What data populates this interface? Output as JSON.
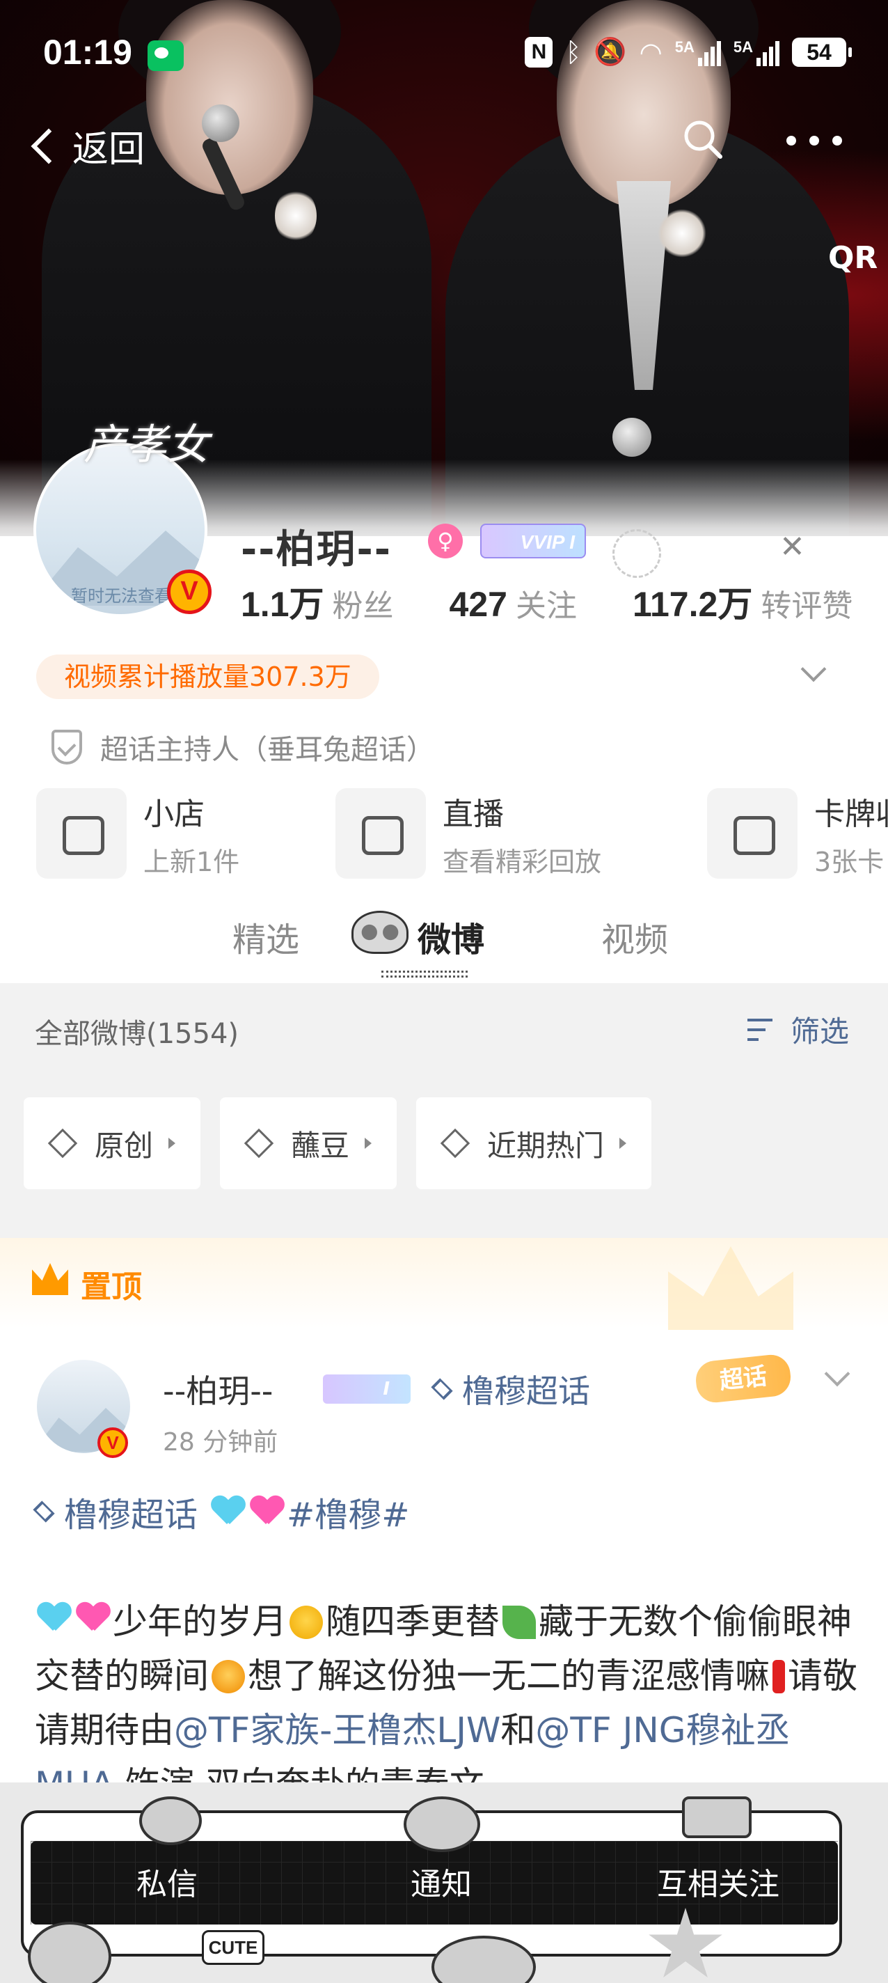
{
  "status_bar": {
    "time": "01:19",
    "nfc": "N",
    "network1": "5A",
    "network2": "5A",
    "battery": "54"
  },
  "nav": {
    "back_label": "返回"
  },
  "profile": {
    "avatar_caption": "暂时无法查看",
    "avatar_deco": "产孝女",
    "verified_mark": "V",
    "name": "--柏玥--",
    "vip_badge": "VVIP I",
    "stats": {
      "fans_count": "1.1万",
      "fans_label": "粉丝",
      "following_count": "427",
      "following_label": "关注",
      "likes_count": "117.2万",
      "likes_label": "转评赞"
    },
    "video_plays": "视频累计播放量307.3万",
    "host_text": "超话主持人（垂耳兔超话）"
  },
  "services": [
    {
      "title": "小店",
      "subtitle": "上新1件"
    },
    {
      "title": "直播",
      "subtitle": "查看精彩回放"
    },
    {
      "title": "卡牌收",
      "subtitle": "3张卡"
    }
  ],
  "tabs": [
    "精选",
    "微博",
    "视频"
  ],
  "feed": {
    "all_label": "全部微博(1554)",
    "filter_label": "筛选",
    "chips": [
      "原创",
      "蘸豆",
      "近期热门"
    ]
  },
  "pinned": {
    "label": "置顶",
    "watermark": "V"
  },
  "post": {
    "author": "--柏玥--",
    "author_badge": "I",
    "topic": "橹穆超话",
    "time": "28 分钟前",
    "tag_label": "超话",
    "tag_line_topic": "橹穆超话",
    "tag_line_hashtag": "#橹穆#",
    "body_part1": "少年的岁月",
    "body_part2": "随四季更替",
    "body_part3": "藏于无数个偷偷眼神交替的瞬间",
    "body_part4": "想了解这份独一无二的青涩感情嘛",
    "body_part5": "请敬请期待由",
    "mention1": "@TF家族-王橹杰LJW",
    "body_part6": "和",
    "mention2": "@TF JNG穆祉丞MUA",
    "body_part7": " 饰演 双向奔赴的青春文"
  },
  "bottom_bar": {
    "messages": "私信",
    "notifications": "通知",
    "mutual": "互相关注",
    "sticker_text": "CUTE"
  },
  "colors": {
    "link": "#4f6a94",
    "orange": "#ff6a00",
    "pinned_orange": "#ff8a00"
  }
}
